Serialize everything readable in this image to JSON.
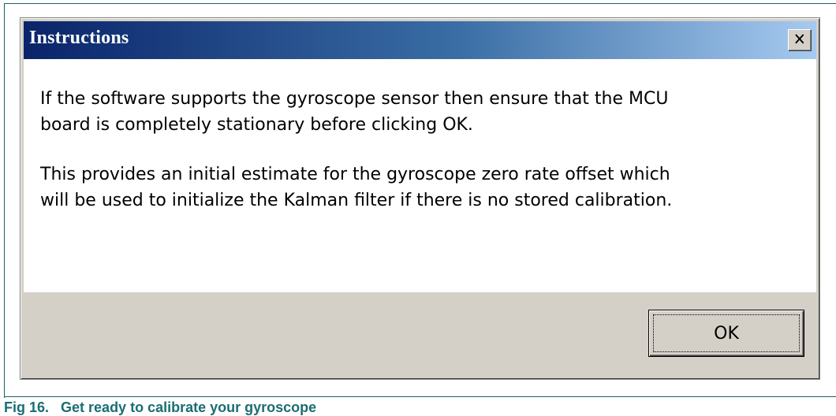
{
  "dialog": {
    "title": "Instructions",
    "close_glyph": "✕",
    "message_paragraphs": [
      "If the software supports the gyroscope sensor then ensure that the MCU\nboard is completely stationary before clicking OK.",
      "This provides an initial estimate for the gyroscope zero rate offset which\nwill be used to initialize the Kalman filter if there is no stored calibration."
    ],
    "ok_label": "OK"
  },
  "caption": {
    "prefix": "Fig 16.",
    "text": "Get ready to calibrate your gyroscope"
  },
  "colors": {
    "title_gradient_start": "#0a246a",
    "title_gradient_end": "#a6caf0",
    "caption_color": "#1a6e73",
    "dialog_face": "#d4d0c8"
  },
  "icons": {
    "close": "close-icon"
  }
}
